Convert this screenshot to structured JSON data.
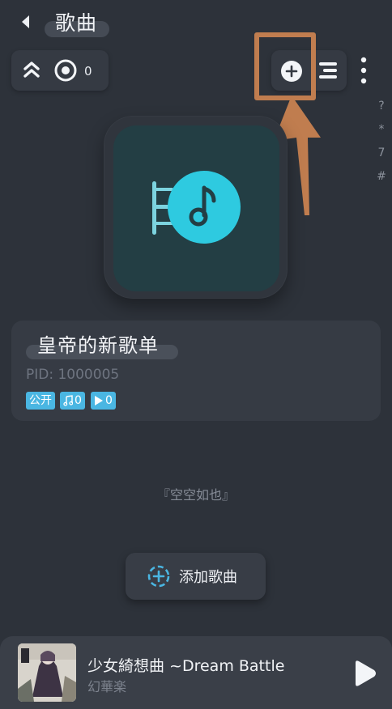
{
  "header": {
    "title": "歌曲",
    "back_icon": "back-arrow-icon"
  },
  "toolbar": {
    "collapse_icon": "chevrons-up-icon",
    "locate_icon": "target-icon",
    "count": "0",
    "add_icon": "add-circle-icon",
    "list_icon": "list-icon",
    "more_icon": "more-vertical-icon"
  },
  "index_bar": [
    "?",
    "*",
    "7",
    "#"
  ],
  "playlist": {
    "name": "皇帝的新歌单",
    "pid": "PID: 1000005",
    "tags": {
      "visibility": "公开",
      "songs": "0",
      "plays": "0"
    },
    "cover_icon": "music-note-icon"
  },
  "empty_text": "『空空如也』",
  "add_song": {
    "label": "添加歌曲",
    "icon": "add-dashed-circle-icon"
  },
  "now_playing": {
    "title": "少女綺想曲 ~Dream Battle",
    "artist": "幻華楽",
    "play_icon": "play-icon"
  },
  "colors": {
    "accent": "#4ab6e2",
    "background": "#2d323a",
    "annotation": "#c07d4f"
  }
}
